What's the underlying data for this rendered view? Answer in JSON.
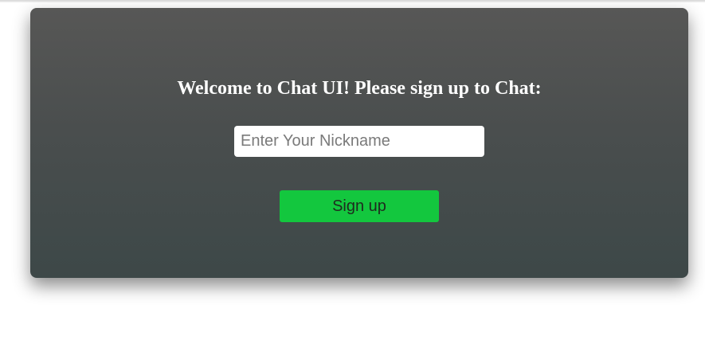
{
  "signup": {
    "heading": "Welcome to Chat UI! Please sign up to Chat:",
    "nickname_placeholder": "Enter Your Nickname",
    "nickname_value": "",
    "button_label": "Sign up"
  },
  "colors": {
    "card_top": "#575756",
    "card_bottom": "#3d4848",
    "button_bg": "#13c73e",
    "heading_text": "#ffffff"
  }
}
